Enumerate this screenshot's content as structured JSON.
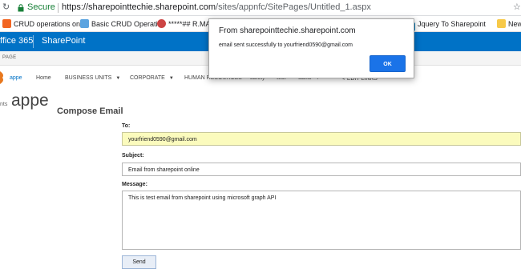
{
  "browser": {
    "secure_label": "Secure",
    "url_host": "https://sharepointtechie.sharepoint.com",
    "url_path": "/sites/appnfc/SitePages/Untitled_1.aspx"
  },
  "bookmarks": [
    {
      "label": "CRUD operations on"
    },
    {
      "label": "Basic CRUD Operatio"
    },
    {
      "label": "*****## R.MARA"
    },
    {
      "label": "Jquery To Sharepoint"
    },
    {
      "label": "New"
    }
  ],
  "suitebar": {
    "office_label": "ffice 365",
    "app_label": "SharePoint"
  },
  "ribbon": {
    "tab_label": "PAGE"
  },
  "nav": {
    "items": [
      {
        "label": "appe"
      },
      {
        "label": "Home"
      },
      {
        "label": "BUSINESS UNITS"
      },
      {
        "label": "CORPORATE"
      },
      {
        "label": "HUMAN RESOURCES"
      },
      {
        "label": "safety"
      },
      {
        "label": "test"
      },
      {
        "label": "tasks"
      },
      {
        "label": "EDIT LINKS"
      }
    ]
  },
  "site": {
    "prefix": "nts",
    "title": "appe",
    "page_heading": "Compose Email"
  },
  "form": {
    "to_label": "To:",
    "to_value": "yourfriend0590@gmail.com",
    "subject_label": "Subject:",
    "subject_value": "Email from sharepoint online",
    "message_label": "Message:",
    "message_value": "This is test email from sharepoint using microsoft graph API",
    "send_label": "Send"
  },
  "dialog": {
    "title": "From sharepointtechie.sharepoint.com",
    "message": "email sent successfully to yourfriend0590@gmail.com",
    "ok_label": "OK"
  },
  "colors": {
    "suitebar": "#0072c6",
    "dialog_button": "#1a73e8",
    "to_field_bg": "#fbfbbd"
  }
}
